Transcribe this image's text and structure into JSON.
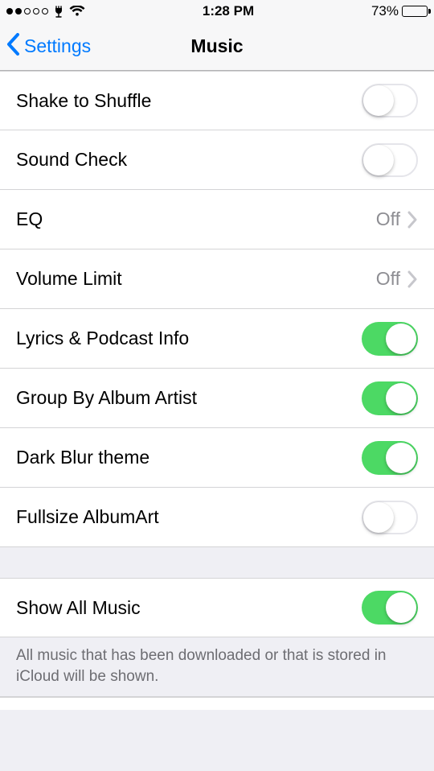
{
  "status_bar": {
    "signal_filled": 2,
    "signal_total": 5,
    "time": "1:28 PM",
    "battery_pct": "73%",
    "battery_fill_pct": 73
  },
  "nav": {
    "back_label": "Settings",
    "title": "Music"
  },
  "rows": {
    "shake": {
      "label": "Shake to Shuffle",
      "type": "toggle",
      "on": false
    },
    "sound": {
      "label": "Sound Check",
      "type": "toggle",
      "on": false
    },
    "eq": {
      "label": "EQ",
      "type": "detail",
      "value": "Off"
    },
    "vol": {
      "label": "Volume Limit",
      "type": "detail",
      "value": "Off"
    },
    "lyrics": {
      "label": "Lyrics & Podcast Info",
      "type": "toggle",
      "on": true
    },
    "group": {
      "label": "Group By Album Artist",
      "type": "toggle",
      "on": true
    },
    "dark": {
      "label": "Dark Blur theme",
      "type": "toggle",
      "on": true
    },
    "art": {
      "label": "Fullsize AlbumArt",
      "type": "toggle",
      "on": false
    },
    "show": {
      "label": "Show All Music",
      "type": "toggle",
      "on": true
    }
  },
  "footer": "All music that has been downloaded or that is stored in iCloud will be shown."
}
